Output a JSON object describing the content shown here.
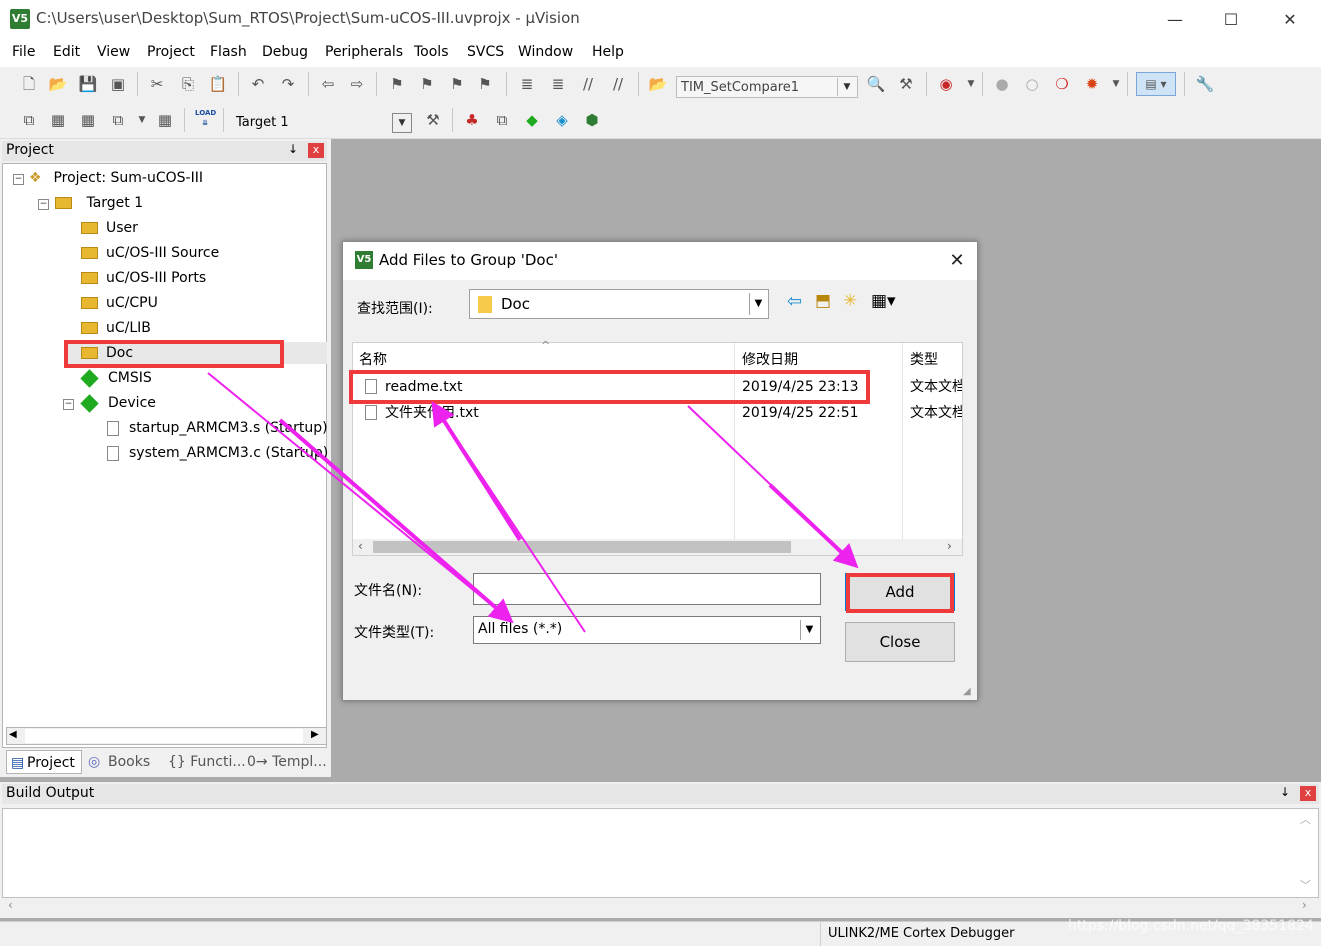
{
  "window": {
    "title": "C:\\Users\\user\\Desktop\\Sum_RTOS\\Project\\Sum-uCOS-III.uvprojx - µVision",
    "minimize": "—",
    "maximize": "☐",
    "close": "✕"
  },
  "menu": [
    "File",
    "Edit",
    "View",
    "Project",
    "Flash",
    "Debug",
    "Peripherals",
    "Tools",
    "SVCS",
    "Window",
    "Help"
  ],
  "toolbar": {
    "find_combo": "TIM_SetCompare1",
    "target_combo": "Target 1",
    "load_label": "LOAD"
  },
  "project_panel": {
    "title": "Project",
    "pin": "↓",
    "close": "x",
    "tree": {
      "project": "Project: Sum-uCOS-III",
      "target": "Target 1",
      "groups": [
        "User",
        "uC/OS-III Source",
        "uC/OS-III Ports",
        "uC/CPU",
        "uC/LIB",
        "Doc"
      ],
      "cmsis": "CMSIS",
      "device": "Device",
      "device_files": [
        "startup_ARMCM3.s (Startup)",
        "system_ARMCM3.c (Startup)"
      ]
    },
    "tabs": [
      "Project",
      "Books",
      "{} Functi...",
      "0→ Templ..."
    ]
  },
  "dialog": {
    "title": "Add Files to Group 'Doc'",
    "look_in_label": "查找范围(I):",
    "look_in_value": "Doc",
    "columns": {
      "name": "名称",
      "modified": "修改日期",
      "type": "类型"
    },
    "files": [
      {
        "name": "readme.txt",
        "modified": "2019/4/25 23:13",
        "type": "文本文档"
      },
      {
        "name": "文件夹作用.txt",
        "modified": "2019/4/25 22:51",
        "type": "文本文档"
      }
    ],
    "filename_label": "文件名(N):",
    "filename_value": "",
    "filetype_label": "文件类型(T):",
    "filetype_value": "All files (*.*)",
    "add_button": "Add",
    "close_button": "Close"
  },
  "build_output": {
    "title": "Build Output"
  },
  "status_bar": {
    "debugger": "ULINK2/ME Cortex Debugger",
    "watermark": "https://blog.csdn.net/qq_38351824"
  },
  "colors": {
    "highlight_red": "#ee3a3a",
    "arrow_magenta": "#ee22ee",
    "app_green": "#2e7d32"
  }
}
